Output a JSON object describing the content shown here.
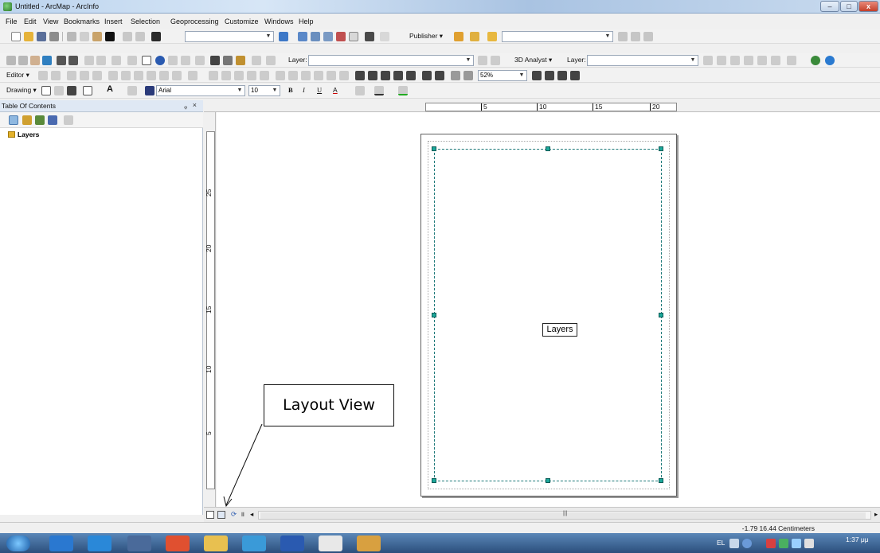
{
  "window": {
    "title": "Untitled - ArcMap - ArcInfo",
    "minimize": "–",
    "maximize": "□",
    "close": "x"
  },
  "menubar": [
    "File",
    "Edit",
    "View",
    "Bookmarks",
    "Insert",
    "Selection",
    "Geoprocessing",
    "Customize",
    "Windows",
    "Help"
  ],
  "toolbar_standard": {
    "publisher_label": "Publisher ▾",
    "scale_value": ""
  },
  "toolbar_tools": {
    "layer_label": "Layer:",
    "analyst_label": "3D Analyst ▾",
    "layer2_label": "Layer:"
  },
  "toolbar_editor": {
    "editor_label": "Editor ▾",
    "zoom_value": "52%"
  },
  "toolbar_drawing": {
    "drawing_label": "Drawing ▾",
    "font_name": "Arial",
    "font_size": "10",
    "bold": "B",
    "italic": "I",
    "underline": "U",
    "font_color": "A"
  },
  "toc": {
    "title": "Table Of Contents",
    "pin": "ᵩ",
    "close": "×",
    "root_layer": "Layers"
  },
  "ruler": {
    "h_labels": [
      "5",
      "10",
      "15",
      "20"
    ],
    "v_labels": [
      "25",
      "20",
      "15",
      "10",
      "5"
    ]
  },
  "layout": {
    "data_frame_label": "Layers"
  },
  "callout": {
    "text": "Layout View"
  },
  "status": {
    "coordinates": "-1.79 16.44 Centimeters"
  },
  "taskbar": {
    "tray_lang": "EL",
    "clock": "1:37 μμ"
  },
  "colors": {
    "handle": "#1ea89b",
    "frame": "#1f7a7a",
    "taskbar": "#2b4f7c"
  }
}
